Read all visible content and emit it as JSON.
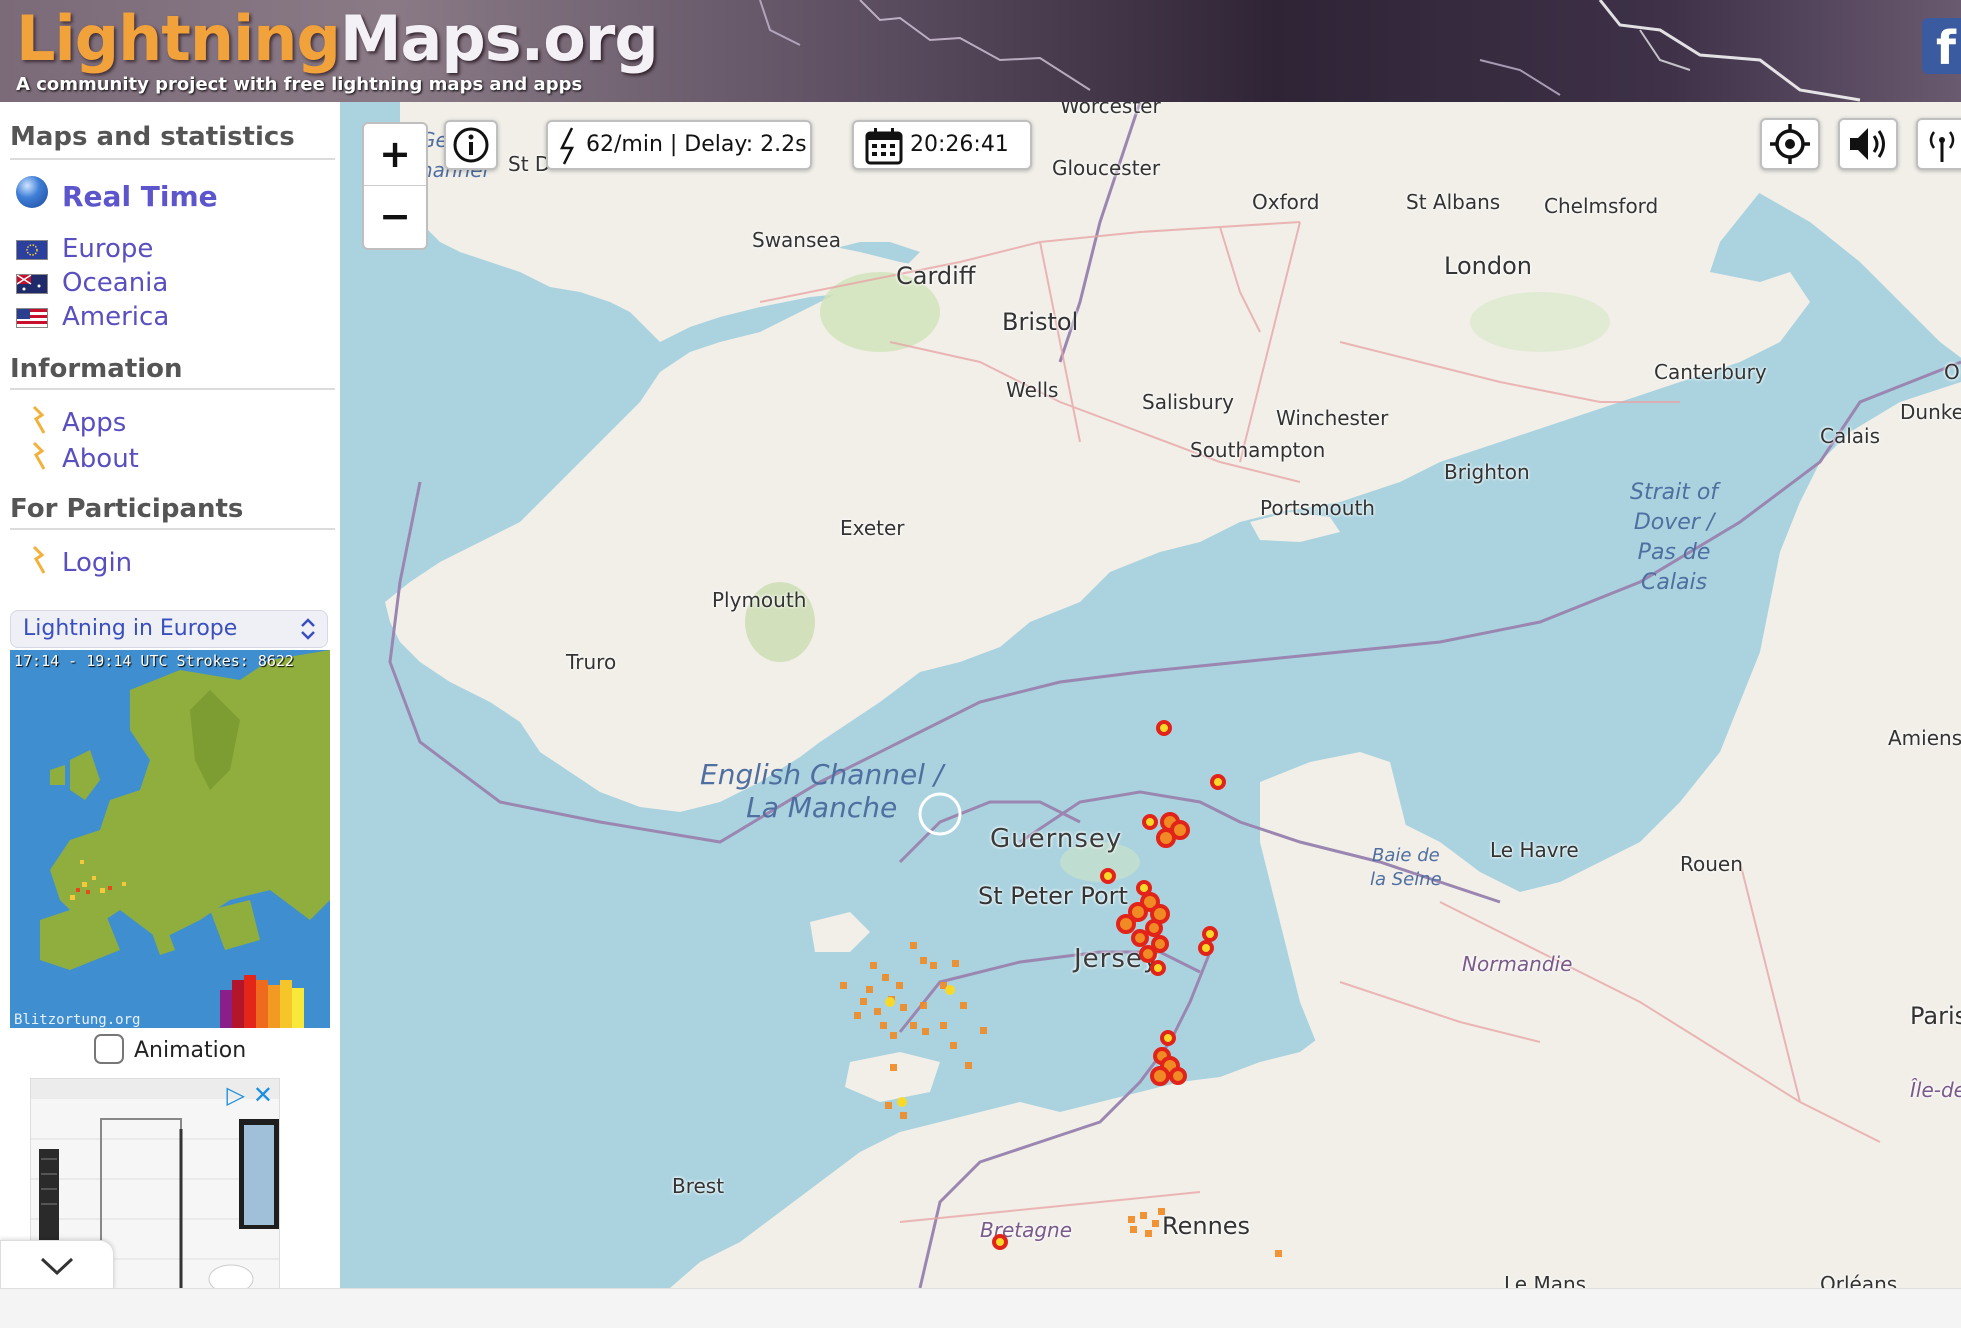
{
  "header": {
    "title_part1": "Lightning",
    "title_part2": "Maps.org",
    "tagline": "A community project with free lightning maps and apps",
    "facebook_glyph": "f"
  },
  "sidebar": {
    "maps_heading": "Maps and statistics",
    "realtime_label": "Real Time",
    "regions": [
      {
        "label": "Europe",
        "icon": "eu-flag-icon"
      },
      {
        "label": "Oceania",
        "icon": "au-flag-icon"
      },
      {
        "label": "America",
        "icon": "us-flag-icon"
      }
    ],
    "info_heading": "Information",
    "info_links": [
      "Apps",
      "About"
    ],
    "participants_heading": "For Participants",
    "login_label": "Login",
    "region_select": "Lightning in Europe",
    "mini_map_caption": "17:14 - 19:14 UTC Strokes: 8622",
    "mini_map_brand": "Blitzortung.org",
    "animation_label": "Animation",
    "animation_checked": false
  },
  "map": {
    "stroke_rate": "62/min | Delay: 2.2s",
    "clock": "20:26:41",
    "places": {
      "worcester": "Worcester",
      "gloucester": "Gloucester",
      "oxford": "Oxford",
      "st_albans": "St Albans",
      "chelmsford": "Chelmsford",
      "swansea": "Swansea",
      "cardiff": "Cardiff",
      "london": "London",
      "bristol": "Bristol",
      "wells": "Wells",
      "salisbury": "Salisbury",
      "winchester": "Winchester",
      "canterbury": "Canterbury",
      "southampton": "Southampton",
      "calais": "Calais",
      "dunkerque": "Dunker",
      "brighton": "Brighton",
      "portsmouth": "Portsmouth",
      "exeter": "Exeter",
      "plymouth": "Plymouth",
      "truro": "Truro",
      "amiens": "Amiens",
      "guernsey": "Guernsey",
      "st_peter_port": "St Peter Port",
      "jersey": "Jersey",
      "le_havre": "Le Havre",
      "rouen": "Rouen",
      "normandie": "Normandie",
      "paris": "Paris",
      "ile_de": "Île-de",
      "brest": "Brest",
      "bretagne": "Bretagne",
      "rennes": "Rennes",
      "le_mans": "Le Mans",
      "orleans": "Orléans",
      "st_d": "St D",
      "o_partial": "O",
      "ge_partial": "Ge",
      "hannel_partial": "hannel"
    },
    "seas": {
      "channel_line1": "English Channel /",
      "channel_line2": "La Manche",
      "dover_lines": [
        "Strait of",
        "Dover /",
        "Pas de",
        "Calais"
      ],
      "seine_lines": [
        "Baie de",
        "la Seine"
      ]
    }
  },
  "colors": {
    "sea": "#aad3df",
    "land": "#f2efe9",
    "link": "#5a4fbf",
    "title_orange": "#f2a23a",
    "strike_red": "#e2231a",
    "strike_orange": "#f08a24",
    "strike_yellow": "#f7d92a"
  }
}
